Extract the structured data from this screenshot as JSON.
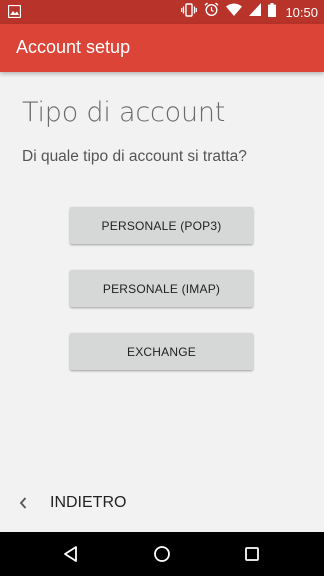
{
  "status_bar": {
    "time": "10:50",
    "icons": [
      "image-notification-icon",
      "vibrate-icon",
      "alarm-icon",
      "wifi-icon",
      "signal-icon",
      "battery-icon"
    ]
  },
  "app_bar": {
    "title": "Account setup",
    "color": "#db4437"
  },
  "main": {
    "heading": "Tipo di account",
    "question": "Di quale tipo di account si tratta?",
    "options": [
      {
        "label": "PERSONALE (POP3)"
      },
      {
        "label": "PERSONALE (IMAP)"
      },
      {
        "label": "EXCHANGE"
      }
    ]
  },
  "footer": {
    "back_label": "INDIETRO",
    "back_icon": "chevron-left-icon"
  },
  "nav_bar": {
    "buttons": [
      "back-triangle-icon",
      "home-circle-icon",
      "recents-square-icon"
    ]
  }
}
